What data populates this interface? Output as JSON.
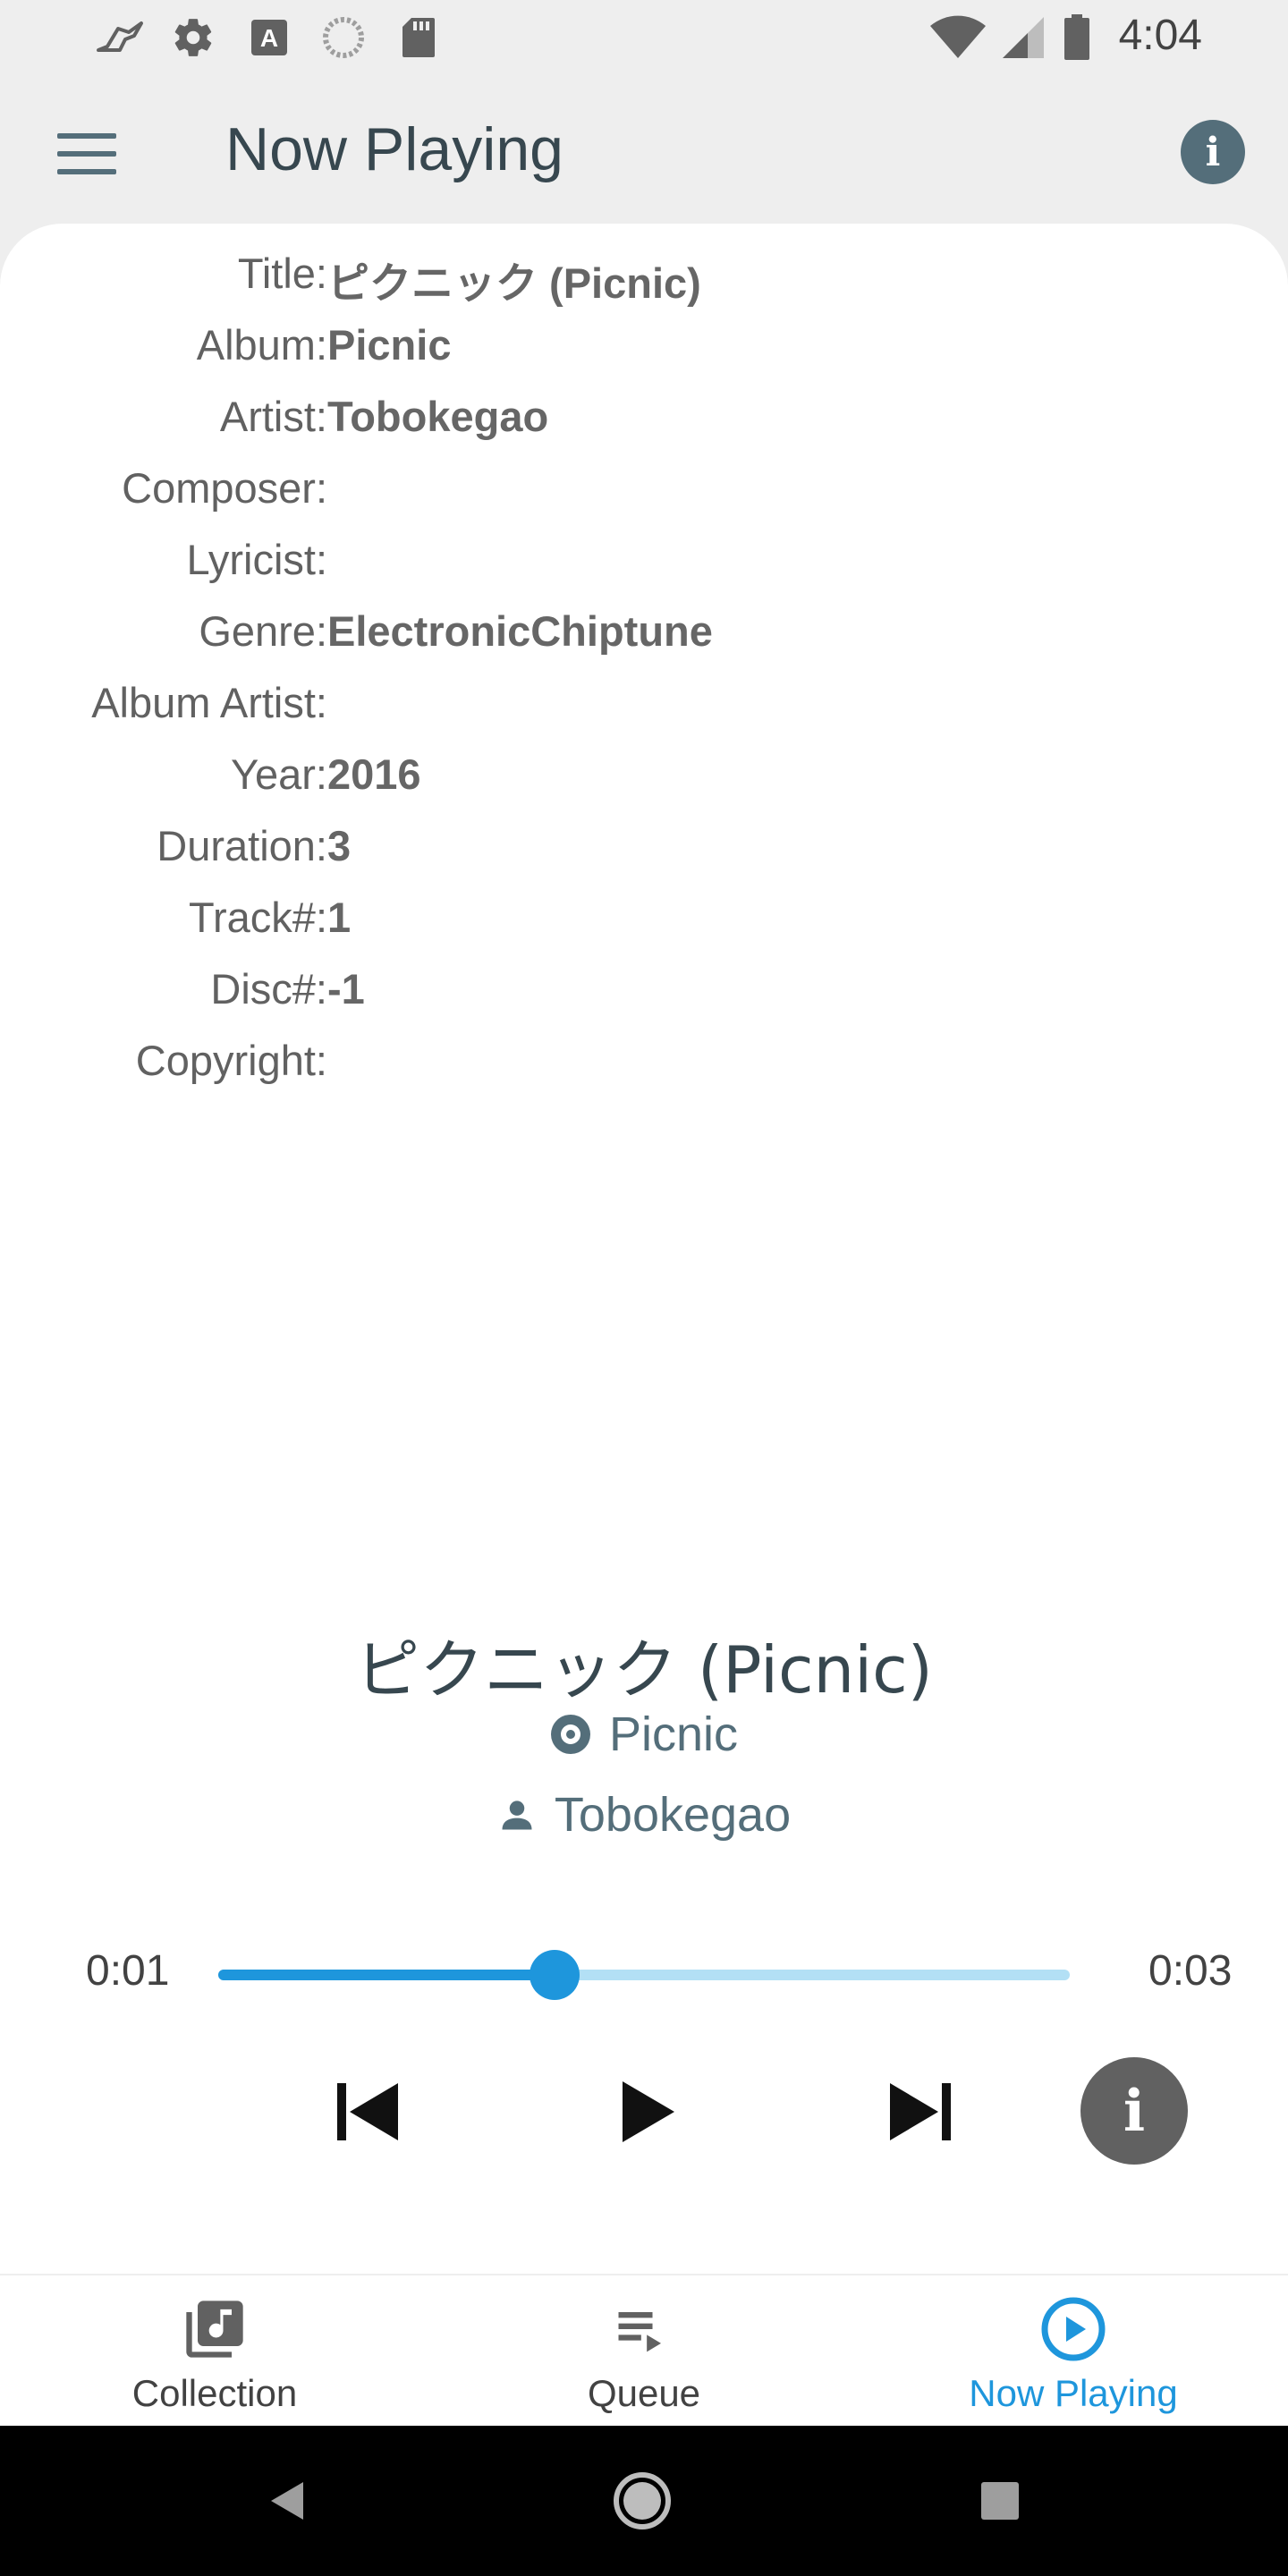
{
  "status_bar": {
    "time": "4:04",
    "left_icons": [
      "bird-icon",
      "gear-icon",
      "font-a-icon",
      "sync-icon",
      "sd-card-icon"
    ],
    "right_icons": [
      "wifi-icon",
      "signal-icon",
      "battery-icon"
    ]
  },
  "app_bar": {
    "title": "Now Playing",
    "menu_icon": "hamburger-menu-icon",
    "info_icon": "info-icon"
  },
  "metadata": {
    "title_label": "Title:",
    "title_value": "ピクニック (Picnic)",
    "album_label": "Album:",
    "album_value": "Picnic",
    "artist_label": "Artist:",
    "artist_value": "Tobokegao",
    "composer_label": "Composer:",
    "composer_value": "",
    "lyricist_label": "Lyricist:",
    "lyricist_value": "",
    "genre_label": "Genre:",
    "genre_value": "ElectronicChiptune",
    "album_artist_label": "Album Artist:",
    "album_artist_value": "",
    "year_label": "Year:",
    "year_value": "2016",
    "duration_label": "Duration:",
    "duration_value": "3",
    "track_label": "Track#:",
    "track_value": "1",
    "disc_label": "Disc#:",
    "disc_value": "-1",
    "copyright_label": "Copyright:",
    "copyright_value": ""
  },
  "player": {
    "track_title": "ピクニック (Picnic)",
    "album": "Picnic",
    "artist": "Tobokegao",
    "elapsed": "0:01",
    "total": "0:03",
    "progress_fraction": 0.395,
    "colors": {
      "accent": "#1e96dc",
      "track": "#b3e0f5"
    }
  },
  "bottom_nav": {
    "items": [
      {
        "label": "Collection",
        "icon": "music-library-icon",
        "active": false
      },
      {
        "label": "Queue",
        "icon": "queue-icon",
        "active": false
      },
      {
        "label": "Now Playing",
        "icon": "play-circle-icon",
        "active": true
      }
    ]
  },
  "system_nav": [
    "back-icon",
    "home-icon",
    "recents-icon"
  ]
}
